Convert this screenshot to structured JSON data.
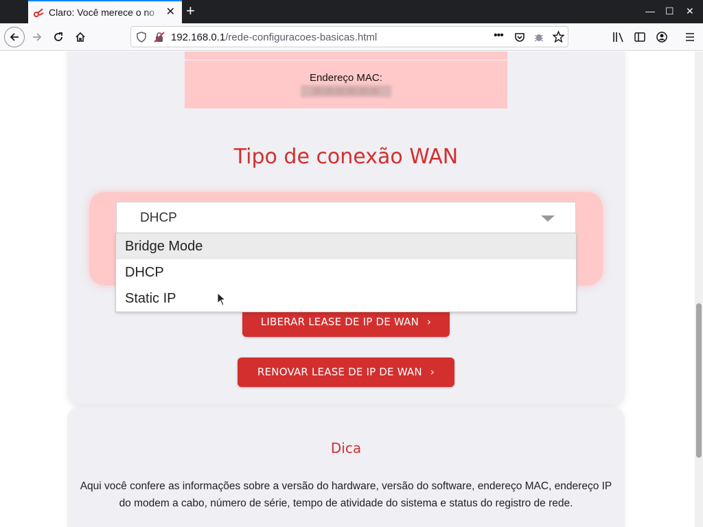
{
  "browser": {
    "tab_title": "Claro: Você merece o no",
    "url_host": "192.168.0.1",
    "url_path": "/rede-configuracoes-basicas.html",
    "new_tab": "+",
    "tab_close": "✕",
    "win_min": "—",
    "win_max": "☐",
    "win_close": "✕",
    "accent": "#0a84ff"
  },
  "mac": {
    "label": "Endereço MAC:",
    "value": "00:00:00:00:00:00"
  },
  "wan": {
    "title": "Tipo de conexão WAN",
    "selected": "DHCP",
    "options": [
      "Bridge Mode",
      "DHCP",
      "Static IP"
    ],
    "highlighted_option": "Bridge Mode"
  },
  "buttons": {
    "liberar": "LIBERAR LEASE DE IP DE WAN",
    "renovar": "RENOVAR LEASE DE IP DE WAN",
    "chevron": "›"
  },
  "dica": {
    "title": "Dica",
    "text": "Aqui você confere as informações sobre a versão do hardware, versão do software, endereço MAC, endereço IP do modem a cabo, número de série, tempo de atividade do sistema e status do registro de rede."
  },
  "colors": {
    "brand_red": "#d32f2f",
    "panel_pink": "#ffc9c9",
    "card_gray": "#efeff4"
  },
  "icons": {
    "back": "arrow-left-icon",
    "forward": "arrow-right-icon",
    "reload": "reload-icon",
    "home": "home-icon",
    "shield": "shield-icon",
    "insecure": "insecure-lock-icon",
    "more": "more-icon",
    "pocket": "pocket-icon",
    "extension": "bug-icon",
    "bookmark": "star-icon",
    "library": "library-icon",
    "sidebar": "sidebar-icon",
    "account": "account-icon",
    "menu": "hamburger-menu-icon"
  }
}
